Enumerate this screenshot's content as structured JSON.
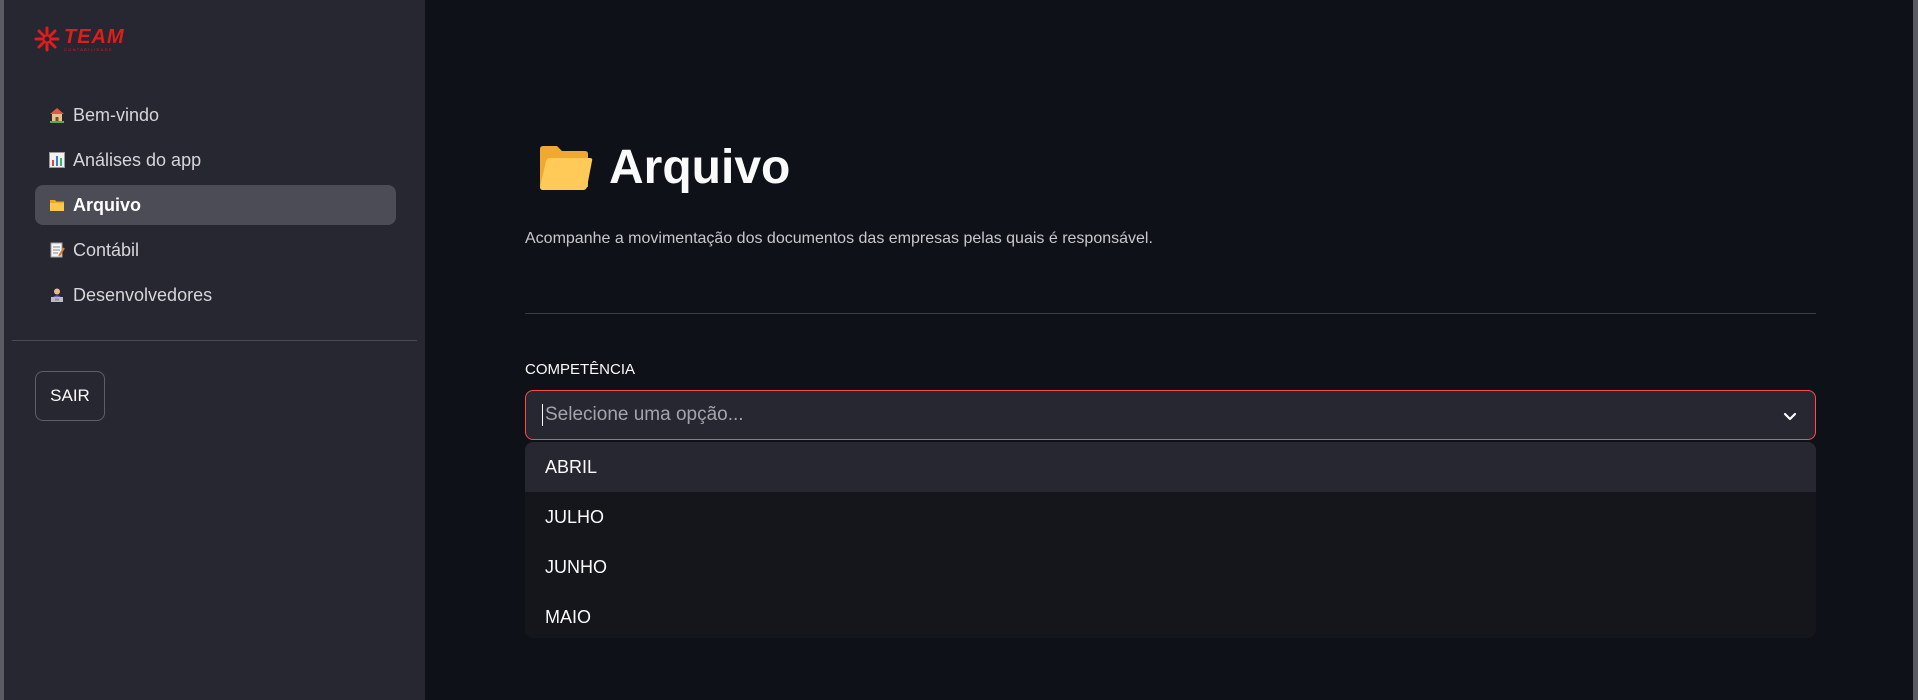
{
  "logo": {
    "name": "TEAM",
    "subtitle": "CONTABILIDADE"
  },
  "sidebar": {
    "items": [
      {
        "label": "Bem-vindo",
        "icon": "house-icon",
        "active": false
      },
      {
        "label": "Análises do app",
        "icon": "bar-chart-icon",
        "active": false
      },
      {
        "label": "Arquivo",
        "icon": "folder-icon",
        "active": true
      },
      {
        "label": "Contábil",
        "icon": "memo-icon",
        "active": false
      },
      {
        "label": "Desenvolvedores",
        "icon": "developer-icon",
        "active": false
      }
    ],
    "logout_label": "SAIR"
  },
  "main": {
    "title": "Arquivo",
    "title_icon": "open-folder-icon",
    "subtitle": "Acompanhe a movimentação dos documentos das empresas pelas quais é responsável.",
    "field_label": "COMPETÊNCIA",
    "select_placeholder": "Selecione uma opção...",
    "options": [
      "ABRIL",
      "JULHO",
      "JUNHO",
      "MAIO"
    ],
    "highlighted_option": "ABRIL"
  },
  "colors": {
    "background": "#0e1117",
    "sidebar": "#262730",
    "accent": "#ff4b4b",
    "brand": "#e01d1d"
  }
}
